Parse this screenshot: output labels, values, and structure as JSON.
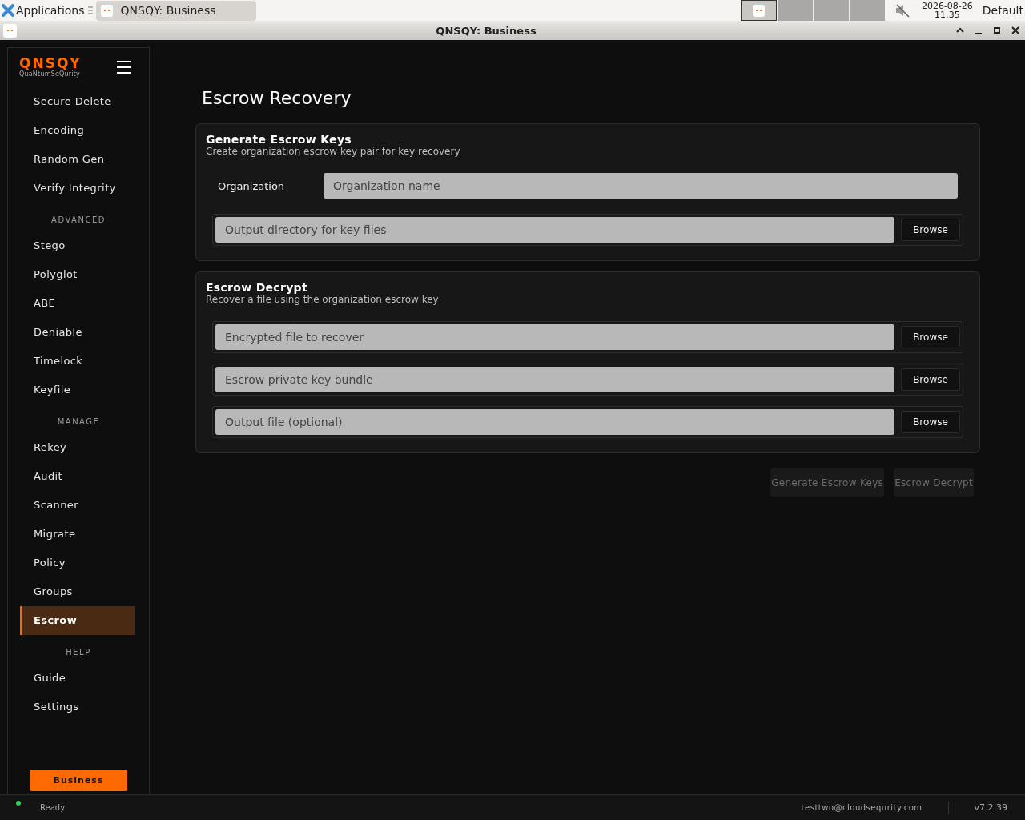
{
  "taskbar": {
    "menu_label": "Applications",
    "tasks": [
      {
        "label": "QNSQY: Business",
        "selected": true
      }
    ],
    "workspaces": [
      {
        "selected": true
      },
      {
        "selected": false
      },
      {
        "selected": false
      },
      {
        "selected": false
      }
    ],
    "muted": true,
    "date": "2026-08-26",
    "time": "11:35",
    "layout": "Default"
  },
  "window": {
    "title": "QNSQY: Business"
  },
  "sidebar": {
    "logo": "QNSQY",
    "tagline": "QuaNtumSeQurity",
    "sections": [
      {
        "items": [
          {
            "label": "Secure Delete",
            "selected": false
          },
          {
            "label": "Encoding",
            "selected": false
          },
          {
            "label": "Random Gen",
            "selected": false
          },
          {
            "label": "Verify Integrity",
            "selected": false
          }
        ]
      },
      {
        "heading": "ADVANCED",
        "items": [
          {
            "label": "Stego",
            "selected": false
          },
          {
            "label": "Polyglot",
            "selected": false
          },
          {
            "label": "ABE",
            "selected": false
          },
          {
            "label": "Deniable",
            "selected": false
          },
          {
            "label": "Timelock",
            "selected": false
          },
          {
            "label": "Keyfile",
            "selected": false
          }
        ]
      },
      {
        "heading": "MANAGE",
        "items": [
          {
            "label": "Rekey",
            "selected": false
          },
          {
            "label": "Audit",
            "selected": false
          },
          {
            "label": "Scanner",
            "selected": false
          },
          {
            "label": "Migrate",
            "selected": false
          },
          {
            "label": "Policy",
            "selected": false
          },
          {
            "label": "Groups",
            "selected": false
          },
          {
            "label": "Escrow",
            "selected": true
          }
        ]
      },
      {
        "heading": "HELP",
        "items": [
          {
            "label": "Guide",
            "selected": false
          },
          {
            "label": "Settings",
            "selected": false
          }
        ]
      }
    ],
    "edition_button": "Business"
  },
  "page": {
    "title": "Escrow Recovery",
    "cards": [
      {
        "title": "Generate Escrow Keys",
        "subtitle": "Create organization escrow key pair for key recovery",
        "fields": [
          {
            "kind": "labeled",
            "label": "Organization",
            "placeholder": "Organization name"
          },
          {
            "kind": "browse",
            "placeholder": "Output directory for key files",
            "button": "Browse"
          }
        ]
      },
      {
        "title": "Escrow Decrypt",
        "subtitle": "Recover a file using the organization escrow key",
        "fields": [
          {
            "kind": "browse",
            "placeholder": "Encrypted file to recover",
            "button": "Browse"
          },
          {
            "kind": "browse",
            "placeholder": "Escrow private key bundle",
            "button": "Browse"
          },
          {
            "kind": "browse",
            "placeholder": "Output file (optional)",
            "button": "Browse"
          }
        ]
      }
    ],
    "actions": [
      {
        "label": "Generate Escrow Keys",
        "disabled": true
      },
      {
        "label": "Escrow Decrypt",
        "disabled": true
      }
    ]
  },
  "status_bar": {
    "status": "Ready",
    "color": "#33cc55",
    "user": "testtwo@cloudsequrity.com",
    "version": "v7.2.39"
  }
}
